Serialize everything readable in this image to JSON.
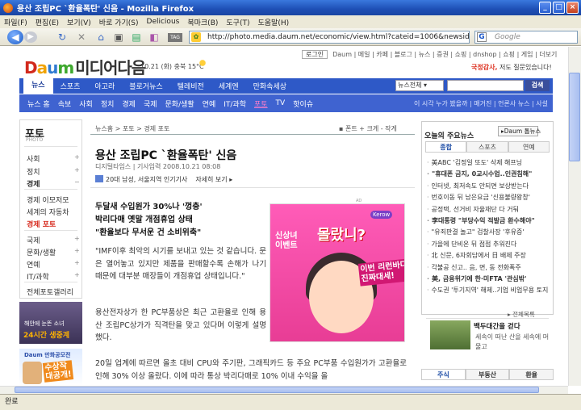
{
  "window": {
    "title": "용산 조립PC `환율폭탄' 신음 - Mozilla Firefox",
    "controls": [
      "_",
      "□",
      "×"
    ]
  },
  "menu": [
    "파일(F)",
    "편집(E)",
    "보기(V)",
    "바로 가기(S)",
    "Delicious",
    "북마크(B)",
    "도구(T)",
    "도움말(H)"
  ],
  "toolbar": {
    "back": "◀",
    "forward": "▶",
    "tag": "TAG",
    "url": "http://photo.media.daum.net/economic/view.html?cateid=1006&newsid=20081O",
    "search_placeholder": "Google"
  },
  "site": {
    "logo": {
      "d1": "D",
      "d2": "a",
      "d3": "u",
      "d4": "m",
      "media": "미디어다음"
    },
    "date": "10.21 (화)  충북 15°C",
    "login": "로그인",
    "top_links": "Daum | 메일 | 카페 | 블로그 | 뉴스 | 증권 | 쇼핑 | dnshop | 쇼핑 | 게임 | 더보기",
    "top_ad": {
      "strong": "국정감사,",
      "rest": " 저도 질문있습니다!"
    },
    "gnb": {
      "active": "뉴스",
      "items": [
        "스포츠",
        "아고라",
        "블로거뉴스",
        "텔레비전",
        "세계엔",
        "만화속세상"
      ],
      "search_select": "뉴스전체 ▾",
      "search_button": "검색"
    },
    "lnb": {
      "items": [
        "뉴스 홈",
        "속보",
        "사회",
        "정치",
        "경제",
        "국제",
        "문화/생활",
        "연예",
        "IT/과학",
        "포토",
        "TV",
        "핫이슈"
      ],
      "selected": "포토",
      "right": "이 시각 누가 봤을까 | 매거진 | 언론사 뉴스 | 사설"
    }
  },
  "left_nav": {
    "title": "포토",
    "subtitle": "PHOTO",
    "group1": [
      "사회",
      "정치",
      "경제"
    ],
    "group2": [
      "경제 이모저모",
      "세계의 자동차",
      "경제 포토"
    ],
    "group3": [
      "국제",
      "문화/생활",
      "연예",
      "IT/과학"
    ],
    "gallery": "전체포토갤러리",
    "plus": "+",
    "banner1": {
      "line1": "해안에 눈뜬 소녀",
      "line2": "24시간 생중계"
    },
    "banner2": {
      "line1": "Daum 만화공모전",
      "line2": "수상작\n대공개!"
    }
  },
  "article": {
    "breadcrumb": "뉴스홈 > 포토 > 경제 포토",
    "tools": "▪ 폰트    + 크게  - 작게",
    "title": "용산 조립PC `환율폭탄' 신음",
    "meta": "디지털타임스 | 기사입력 2008.10.21 08:08",
    "top_info": {
      "demo": "20대 남성, 서울지역 인기기사",
      "more": "자세히 보기 ▸"
    },
    "summary": [
      "두달새 수입원가 30%나 '껑충'",
      "박리다매 옛말 개점휴업 상태",
      "\"환율보다 무서운 건 소비위축\""
    ],
    "para1": "\"IMF이후 최악의 시기를 보내고 있는 것 같습니다. 문은 열어놓고 있지만 제품을 판매할수록 손해가 나기 때문에 대부분 매장들이 개점휴업 상태입니다.\"",
    "para2": "용산전자상가 한 PC부품상은 최근 고환율로 인해 용산 조립PC상가가 직격탄을 맞고 있다며 이렇게 설명했다.",
    "para3": "20일 업계에 따르면 올초 대비 CPU와 주기판, 그래픽카드 등 주요 PC부품 수입원가가 고환율로 인해 30% 이상 올랐다. 이에 따라 통상 박리다매로 10% 이내 수익을 올",
    "ad": {
      "label": "AD",
      "logo": "Kerow",
      "text1": "신상녀\n이벤트",
      "text2": "몰랐니?",
      "text3": "이번 리런바디가\n진짜대세!"
    }
  },
  "right_col": {
    "title": "오늘의 주요뉴스",
    "daum_button": "▸Daum 톱뉴스",
    "tabs": [
      "종합",
      "스포츠",
      "연예"
    ],
    "active_tab": "종합",
    "news": [
      {
        "text": "美ABC '김정일 또도' 삭제 해프닝",
        "bold": false
      },
      {
        "text": "\"휴대폰 금지, 0교시수업..인권침해\"",
        "bold": true
      },
      {
        "text": "인터넷, 최저속도 안되면 보상받는다",
        "bold": false
      },
      {
        "text": "번호이동 뒤 남은요금 '신용불량왕창'",
        "bold": false
      },
      {
        "text": "공정택, 선거비 자율재단 다 거둬",
        "bold": false
      },
      {
        "text": "李대통령 \"부당수익 적발금 환수해야\"",
        "bold": true
      },
      {
        "text": "\"유죄판결 놀고\" 검찰사장 '후유증'",
        "bold": false
      },
      {
        "text": "가을에 단비온 뒤 점점 추워진다",
        "bold": false
      },
      {
        "text": "北 신문, 6자회담에서 日 배제 주장",
        "bold": false
      },
      {
        "text": "각불공 신고.. 음, 면, 동 전화폭주",
        "bold": false
      },
      {
        "text": "美, 금융위기에 한·미FTA '관심밖'",
        "bold": true
      },
      {
        "text": "수도권 '투기지역' 해제..기업 비업무용 토지 대입 6조 투입",
        "bold": false
      }
    ],
    "more": "▸ 전체목록",
    "photo": {
      "title": "백두대간을 걷다",
      "desc": "세속이 떠난 산을 세속에 머물고"
    },
    "tabs2": [
      "주식",
      "부동산",
      "환율"
    ]
  },
  "status": "완료"
}
